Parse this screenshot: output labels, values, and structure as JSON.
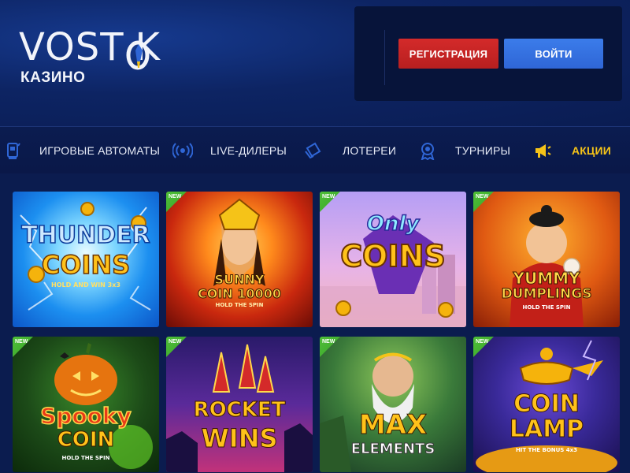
{
  "header": {
    "logo": {
      "before_o": "VOST",
      "after_o": "K",
      "sub": "КАЗИНО"
    },
    "register_label": "РЕГИСТРАЦИЯ",
    "login_label": "ВОЙТИ"
  },
  "nav": {
    "items": [
      {
        "label": "ИГРОВЫЕ АВТОМАТЫ",
        "icon": "slot-machine-icon"
      },
      {
        "label": "LIVE-ДИЛЕРЫ",
        "icon": "live-broadcast-icon"
      },
      {
        "label": "ЛОТЕРЕИ",
        "icon": "lottery-tickets-icon"
      },
      {
        "label": "ТУРНИРЫ",
        "icon": "tournament-medal-icon"
      },
      {
        "label": "АКЦИИ",
        "icon": "megaphone-icon"
      }
    ]
  },
  "games": [
    {
      "title_line1": "THUNDER",
      "title_line2": "COINS",
      "subtitle": "HOLD AND WIN 3x3",
      "badge": ""
    },
    {
      "title_line1": "SUNNY",
      "title_line2": "COIN 10000",
      "subtitle": "HOLD THE SPIN",
      "badge": "NEW"
    },
    {
      "title_line1": "Only",
      "title_line2": "COINS",
      "subtitle": "",
      "badge": "NEW"
    },
    {
      "title_line1": "YUMMY",
      "title_line2": "DUMPLINGS",
      "subtitle": "HOLD THE SPIN",
      "badge": "NEW"
    },
    {
      "title_line1": "Spooky",
      "title_line2": "COIN",
      "subtitle": "HOLD THE SPIN",
      "badge": "NEW"
    },
    {
      "title_line1": "ROCKET",
      "title_line2": "WINS",
      "subtitle": "",
      "badge": "NEW"
    },
    {
      "title_line1": "MAX",
      "title_line2": "ELEMENTS",
      "subtitle": "",
      "badge": "NEW"
    },
    {
      "title_line1": "COIN",
      "title_line2": "LAMP",
      "subtitle": "HIT THE BONUS 4x3",
      "badge": "NEW"
    }
  ],
  "colors": {
    "background": "#0c1e52",
    "register": "#d42a2a",
    "login": "#3b7cea",
    "promo": "#f5c318",
    "new_badge": "#4fbf38"
  }
}
